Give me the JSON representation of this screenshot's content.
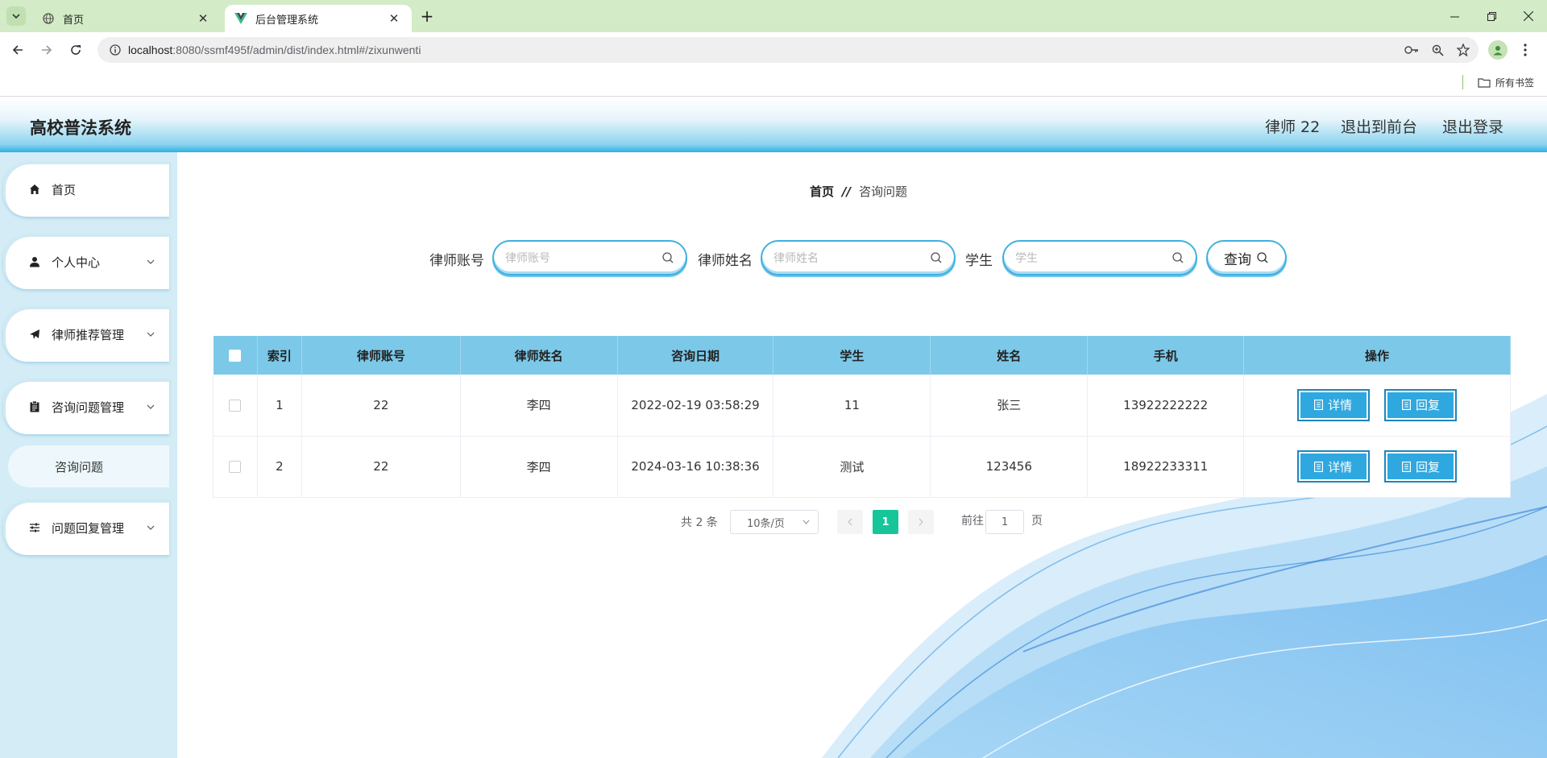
{
  "browser": {
    "tabs": [
      {
        "title": "首页",
        "active": false
      },
      {
        "title": "后台管理系统",
        "active": true
      }
    ],
    "url_host": "localhost",
    "url_rest": ":8080/ssmf495f/admin/dist/index.html#/zixunwenti",
    "bookmarks_label": "所有书签"
  },
  "header": {
    "title": "高校普法系统",
    "user": "律师 22",
    "to_front": "退出到前台",
    "logout": "退出登录"
  },
  "sidebar": {
    "items": [
      {
        "label": "首页",
        "icon": "home-icon"
      },
      {
        "label": "个人中心",
        "icon": "user-icon"
      },
      {
        "label": "律师推荐管理",
        "icon": "paper-plane-icon"
      },
      {
        "label": "咨询问题管理",
        "icon": "clipboard-icon"
      },
      {
        "label": "问题回复管理",
        "icon": "sliders-icon"
      }
    ],
    "sub_item": "咨询问题"
  },
  "breadcrumb": {
    "home": "首页",
    "separator": "//",
    "current": "咨询问题"
  },
  "search": {
    "lawyer_account_label": "律师账号",
    "lawyer_account_placeholder": "律师账号",
    "lawyer_name_label": "律师姓名",
    "lawyer_name_placeholder": "律师姓名",
    "student_label": "学生",
    "student_placeholder": "学生",
    "query_label": "查询"
  },
  "table": {
    "columns": [
      "索引",
      "律师账号",
      "律师姓名",
      "咨询日期",
      "学生",
      "姓名",
      "手机",
      "操作"
    ],
    "rows": [
      {
        "index": "1",
        "lawyer_account": "22",
        "lawyer_name": "李四",
        "date": "2022-02-19 03:58:29",
        "student": "11",
        "name": "张三",
        "phone": "13922222222"
      },
      {
        "index": "2",
        "lawyer_account": "22",
        "lawyer_name": "李四",
        "date": "2024-03-16 10:38:36",
        "student": "测试",
        "name": "123456",
        "phone": "18922233311"
      }
    ],
    "detail_label": "详情",
    "reply_label": "回复"
  },
  "pagination": {
    "total": "共 2 条",
    "page_size": "10条/页",
    "current_page": "1",
    "goto_prefix": "前往",
    "goto_value": "1",
    "goto_suffix": "页"
  },
  "colors": {
    "accent": "#2fa8e0",
    "table_header": "#7cc8e8",
    "sidebar_bg": "#d3ecf6",
    "pager_active": "#17c59b"
  }
}
